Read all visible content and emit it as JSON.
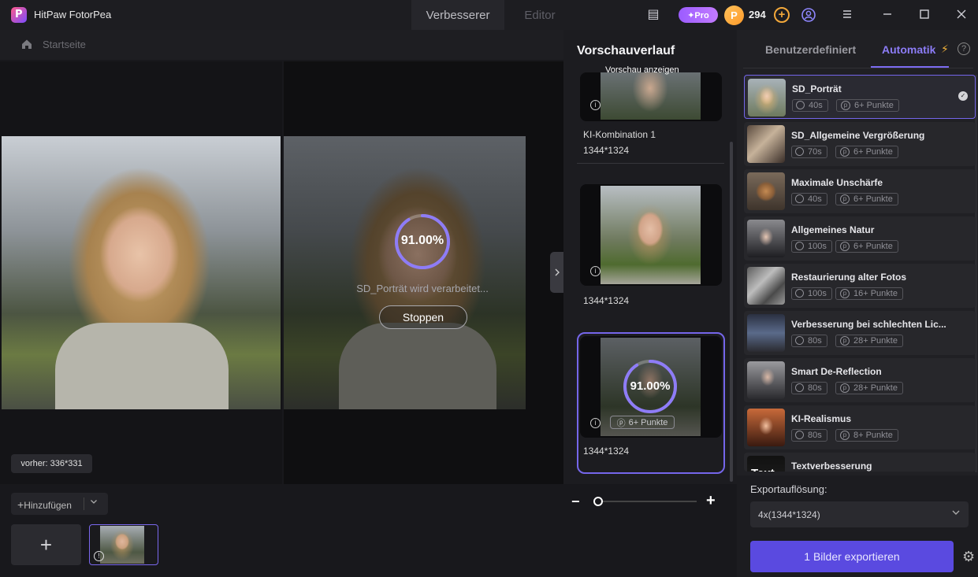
{
  "app": {
    "title": "HitPaw FotorPea",
    "logo_letter": "P"
  },
  "tabs": [
    {
      "label": "Verbesserer",
      "active": true
    },
    {
      "label": "Editor",
      "active": false
    }
  ],
  "header": {
    "pro_label": "✦Pro",
    "coins": "294",
    "coin_letter": "P"
  },
  "breadcrumb": {
    "home": "Startseite"
  },
  "preview": {
    "progress": "91.00%",
    "progress_value": 0.91,
    "processing_text": "SD_Porträt wird verarbeitet...",
    "stop_label": "Stoppen",
    "before_label": "vorher: 336*331"
  },
  "tray": {
    "add_label": "Hinzufügen"
  },
  "history": {
    "title": "Vorschauverlauf",
    "items": [
      {
        "caption": "Vorschau anzeigen",
        "name": "KI-Kombination 1",
        "size": "1344*1324"
      },
      {
        "name": "",
        "size": "1344*1324"
      },
      {
        "name": "",
        "size": "1344*1324",
        "progress": "91.00%",
        "progress_value": 0.91,
        "points": "6+ Punkte"
      }
    ]
  },
  "panel": {
    "tab_custom": "Benutzerdefiniert",
    "tab_auto": "Automatik",
    "models": [
      {
        "name": "SD_Porträt",
        "time": "40s",
        "points": "6+ Punkte",
        "selected": true
      },
      {
        "name": "SD_Allgemeine Vergrößerung",
        "time": "70s",
        "points": "6+ Punkte"
      },
      {
        "name": "Maximale Unschärfe",
        "time": "40s",
        "points": "6+ Punkte"
      },
      {
        "name": "Allgemeines Natur",
        "time": "100s",
        "points": "6+ Punkte"
      },
      {
        "name": "Restaurierung alter Fotos",
        "time": "100s",
        "points": "16+ Punkte"
      },
      {
        "name": "Verbesserung bei schlechten Lic...",
        "time": "80s",
        "points": "28+ Punkte"
      },
      {
        "name": "Smart De-Reflection",
        "time": "80s",
        "points": "28+ Punkte"
      },
      {
        "name": "KI-Realismus",
        "time": "80s",
        "points": "8+ Punkte"
      },
      {
        "name": "Textverbesserung",
        "time": "",
        "points": "",
        "thumb_text": "Text"
      }
    ],
    "export_label": "Exportauflösung:",
    "export_value": "4x(1344*1324)",
    "export_button": "1 Bilder exportieren"
  },
  "colors": {
    "accent": "#7566ea",
    "export_button": "#5a4ae0",
    "pro_badge": "#9b5cff",
    "coin": "#ffb040"
  }
}
